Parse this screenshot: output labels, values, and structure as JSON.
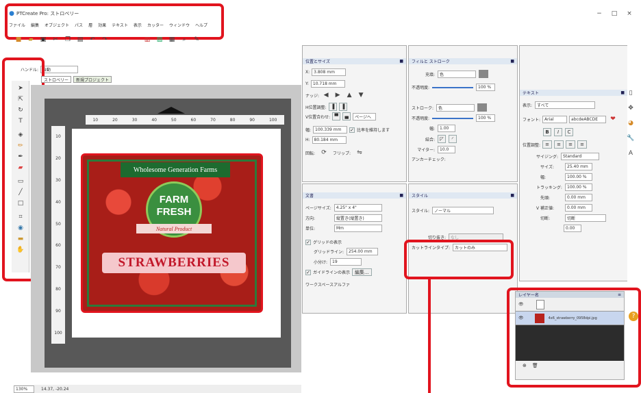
{
  "app": {
    "title": "PTCreate Pro: ストロベリー",
    "menu": [
      "ファイル",
      "編集",
      "オブジェクト",
      "パス",
      "層",
      "効果",
      "テキスト",
      "表示",
      "カッター",
      "ウィンドウ",
      "ヘルプ"
    ]
  },
  "controls": {
    "minimize": "−",
    "maximize": "□",
    "close": "×"
  },
  "handle": {
    "label": "ハンドル:",
    "value": "自動"
  },
  "tabs": [
    "ストロベリー",
    "新規プロジェクト"
  ],
  "ruler_top": [
    "10",
    "20",
    "30",
    "40",
    "50",
    "60",
    "70",
    "80",
    "90",
    "100"
  ],
  "ruler_left": [
    "10",
    "20",
    "30",
    "40",
    "50",
    "60",
    "70",
    "80",
    "90",
    "100"
  ],
  "artwork": {
    "banner": "Wholesome Generation Farms",
    "farm": "FARM",
    "fresh": "FRESH",
    "ribbon": "Natural Product",
    "title": "STRAWBERRIES"
  },
  "position_panel": {
    "title": "位置とサイズ",
    "x_label": "X:",
    "x": "3.808 mm",
    "y_label": "Y:",
    "y": "10.718 mm",
    "nudge": "ナッジ:",
    "halign": "H位置調整:",
    "valign": "V位置合わせ:",
    "page": "ページへ",
    "w_label": "幅:",
    "w": "100.339 mm",
    "h_label": "H:",
    "h": "80.184 mm",
    "ratio": "比率を維持します",
    "rotate": "回転:",
    "flip": "フリップ:"
  },
  "fill_panel": {
    "title": "フィルと ストローク",
    "fill_label": "充填:",
    "fill": "色",
    "fill_opacity": "不透明度:",
    "fill_pct": "100 %",
    "stroke_label": "ストローク:",
    "stroke": "色",
    "stroke_opacity": "不透明度:",
    "stroke_pct": "100 %",
    "width": "幅:",
    "width_val": "1.00",
    "join": "結合:",
    "miter": "マイター:",
    "miter_val": "10.0",
    "anchor": "アンカーチェック:"
  },
  "text_panel": {
    "title": "テキスト",
    "show_label": "表示:",
    "show": "すべて",
    "font_label": "フォント:",
    "font": "Arial",
    "sample": "abcdeABCDE",
    "bold": "B",
    "italic": "I",
    "align_label": "位置調整:",
    "sizing_label": "サイジング:",
    "sizing": "Standard",
    "size_label": "サイズ:",
    "size": "25.40 mm",
    "width_label": "幅:",
    "width": "100.00 %",
    "tracking_label": "トラッキング:",
    "tracking": "100.00 %",
    "leading_label": "先頭:",
    "leading": "0.00 mm",
    "vert_label": "V 補正値:",
    "vert": "0.00 mm",
    "cutline_label": "切断:",
    "cutline": "切断",
    "offset": "0.00"
  },
  "doc_panel": {
    "title": "文書",
    "page_label": "ページサイズ:",
    "page": "4.25\" x 4\"",
    "orient_label": "方向:",
    "orient": "縦置き(縦置き)",
    "unit_label": "単位:",
    "unit": "Mm",
    "grid": "グリッドの表示",
    "gridline_label": "グリッドライン:",
    "gridline": "254.00 mm",
    "subdiv_label": "小分け:",
    "subdiv": "19",
    "guide": "ガイドラインの表示",
    "edit": "編集...",
    "workspace": "ワークスペースアルファ"
  },
  "style_panel": {
    "title": "スタイル",
    "style_label": "スタイル:",
    "style": "ノーマル",
    "cut_label": "切り抜き:",
    "cut": "なし",
    "cutline_label": "カットラインタイプ:",
    "cutline": "カットのみ"
  },
  "layers_panel": {
    "title": "レイヤー名",
    "layer1": "",
    "layer2": "4x6_strawberry_0958dpi.jpg"
  },
  "status": {
    "zoom": "130%",
    "coords": "14.37, -20.24"
  },
  "colors": {
    "accent_red": "#e1141e",
    "canvas": "#585858",
    "art_green": "#1d6b2f"
  }
}
